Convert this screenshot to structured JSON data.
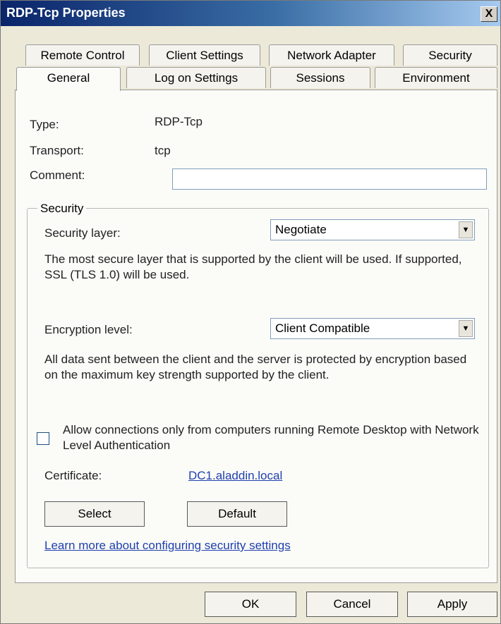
{
  "window": {
    "title": "RDP-Tcp Properties",
    "close_label": "X"
  },
  "tabs": {
    "row1": [
      "Remote Control",
      "Client Settings",
      "Network Adapter",
      "Security"
    ],
    "row2": [
      "General",
      "Log on Settings",
      "Sessions",
      "Environment"
    ],
    "active": "General"
  },
  "general": {
    "type_label": "Type:",
    "type_value": "RDP-Tcp",
    "transport_label": "Transport:",
    "transport_value": "tcp",
    "comment_label": "Comment:",
    "comment_value": ""
  },
  "security_group": {
    "title": "Security",
    "security_layer_label": "Security layer:",
    "security_layer_value": "Negotiate",
    "security_layer_desc": "The most secure layer that is supported by the client will be used. If supported, SSL (TLS 1.0) will be used.",
    "encryption_level_label": "Encryption level:",
    "encryption_level_value": "Client Compatible",
    "encryption_level_desc": "All data sent between the client and the server is protected by encryption based on the maximum key strength supported by the client.",
    "nla_checkbox_label": "Allow connections only from computers running Remote Desktop with Network Level Authentication",
    "nla_checked": false,
    "certificate_label": "Certificate:",
    "certificate_value": "DC1.aladdin.local",
    "select_button": "Select",
    "default_button": "Default",
    "learn_more_link": "Learn more about configuring security settings"
  },
  "footer": {
    "ok": "OK",
    "cancel": "Cancel",
    "apply": "Apply"
  },
  "icons": {
    "close": "close-icon",
    "dropdown": "chevron-down-icon"
  }
}
